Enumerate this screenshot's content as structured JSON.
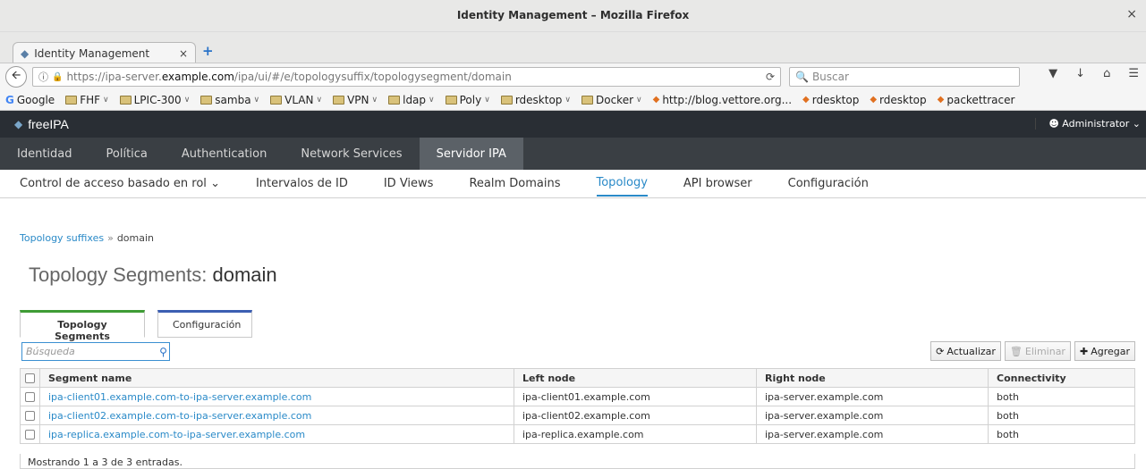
{
  "window": {
    "title": "Identity Management – Mozilla Firefox",
    "close_glyph": "×"
  },
  "browser": {
    "tab_title": "Identity Management",
    "tab_close": "×",
    "new_tab": "+",
    "url_prefix": "https://ipa-server.",
    "url_host": "example.com",
    "url_path": "/ipa/ui/#/e/topologysuffix/topologysegment/domain",
    "search_placeholder": "Buscar",
    "bookmarks": [
      {
        "label": "Google",
        "icon": "google-icon"
      },
      {
        "label": "FHF",
        "icon": "folder-icon"
      },
      {
        "label": "LPIC-300",
        "icon": "folder-icon"
      },
      {
        "label": "samba",
        "icon": "folder-icon"
      },
      {
        "label": "VLAN",
        "icon": "folder-icon"
      },
      {
        "label": "VPN",
        "icon": "folder-icon"
      },
      {
        "label": "ldap",
        "icon": "folder-icon"
      },
      {
        "label": "Poly",
        "icon": "folder-icon"
      },
      {
        "label": "rdesktop",
        "icon": "folder-icon"
      },
      {
        "label": "Docker",
        "icon": "folder-icon"
      },
      {
        "label": "http://blog.vettore.org...",
        "icon": "site-icon"
      },
      {
        "label": "rdesktop",
        "icon": "site-icon"
      },
      {
        "label": "rdesktop",
        "icon": "site-icon"
      },
      {
        "label": "packettracer",
        "icon": "site-icon"
      }
    ]
  },
  "ipa": {
    "brand": "freeIPA",
    "user": "Administrator",
    "main_nav": [
      "Identidad",
      "Política",
      "Authentication",
      "Network Services",
      "Servidor IPA"
    ],
    "sub_nav": [
      "Control de acceso basado en rol",
      "Intervalos de ID",
      "ID Views",
      "Realm Domains",
      "Topology",
      "API browser",
      "Configuración"
    ],
    "breadcrumb": {
      "parent": "Topology suffixes",
      "sep": "»",
      "current": "domain"
    },
    "title_prefix": "Topology Segments:",
    "title_name": "domain",
    "facets": [
      "Topology Segments",
      "Configuración"
    ],
    "search_placeholder": "Búsqueda",
    "buttons": {
      "refresh": "Actualizar",
      "delete": "Eliminar",
      "add": "Agregar"
    },
    "table": {
      "headers": [
        "Segment name",
        "Left node",
        "Right node",
        "Connectivity"
      ],
      "rows": [
        [
          "ipa-client01.example.com-to-ipa-server.example.com",
          "ipa-client01.example.com",
          "ipa-server.example.com",
          "both"
        ],
        [
          "ipa-client02.example.com-to-ipa-server.example.com",
          "ipa-client02.example.com",
          "ipa-server.example.com",
          "both"
        ],
        [
          "ipa-replica.example.com-to-ipa-server.example.com",
          "ipa-replica.example.com",
          "ipa-server.example.com",
          "both"
        ]
      ],
      "footer": "Mostrando 1 a 3 de 3 entradas."
    }
  }
}
